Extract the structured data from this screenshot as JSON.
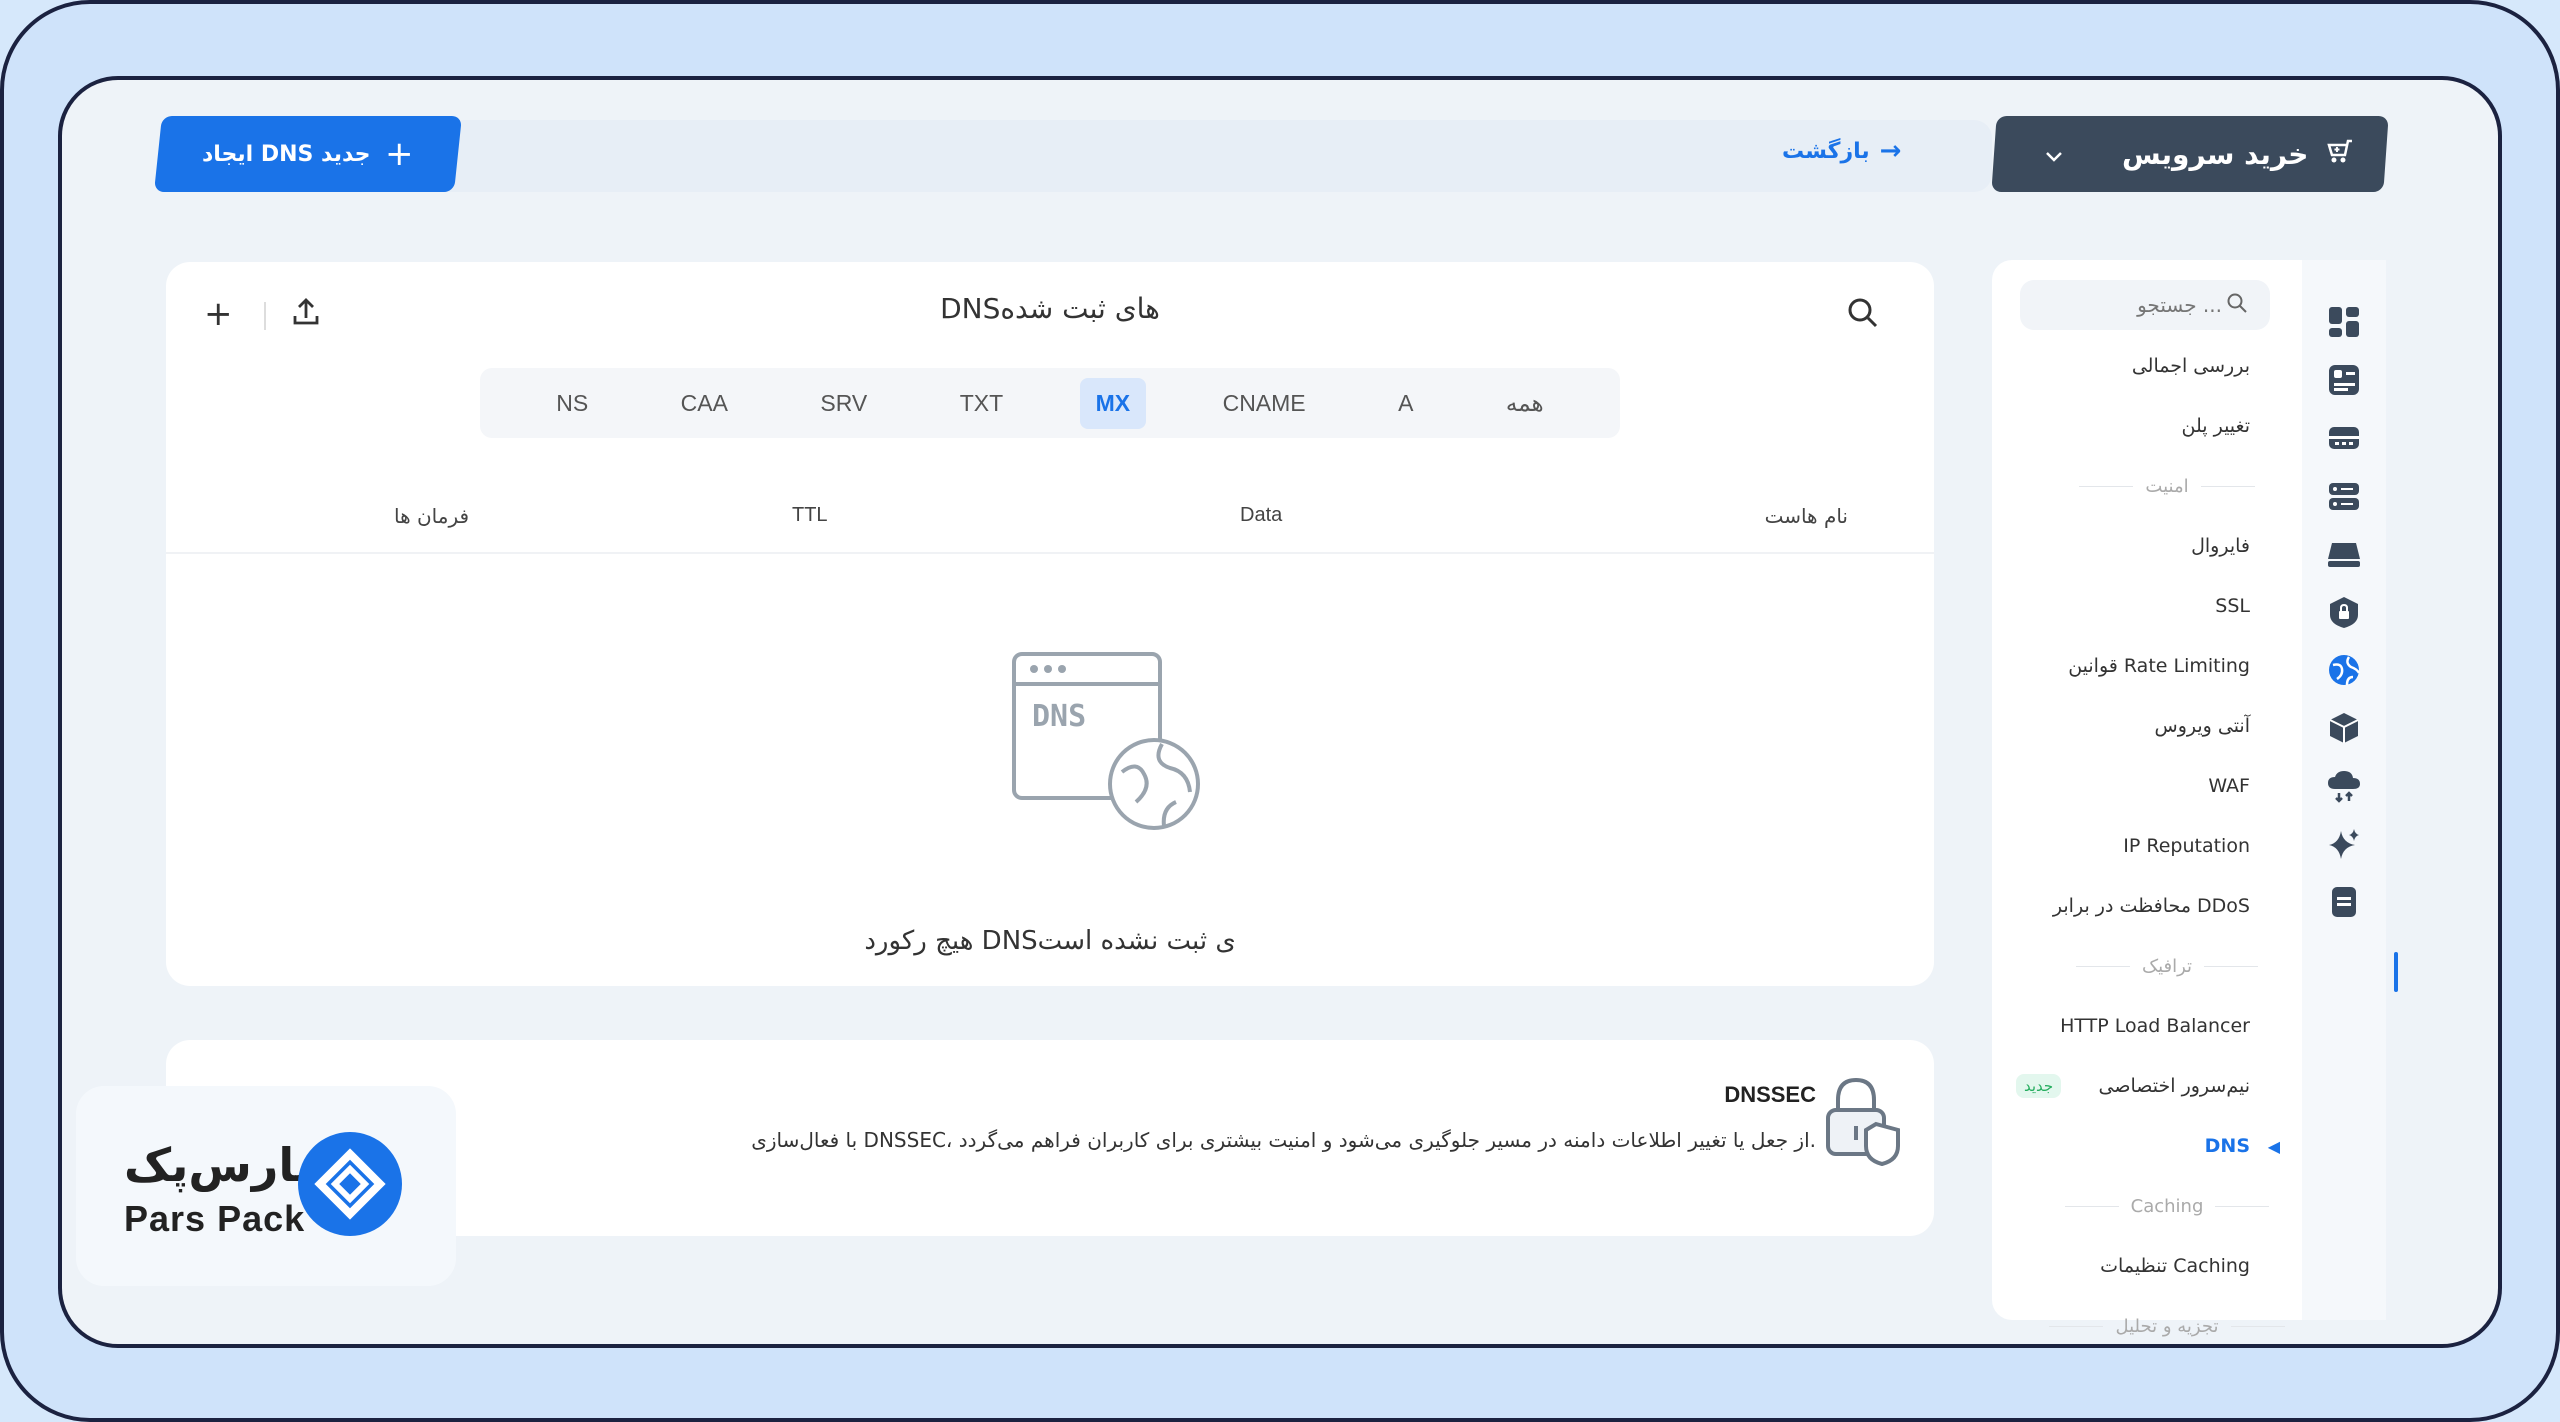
{
  "header": {
    "create_dns_label": "ایجاد DNS جدید",
    "back_label": "بازگشت",
    "buy_service_label": "خرید سرویس"
  },
  "main": {
    "title": "DNSهای ثبت شده",
    "tabs": [
      "همه",
      "A",
      "CNAME",
      "MX",
      "TXT",
      "SRV",
      "CAA",
      "NS"
    ],
    "active_tab": "MX",
    "columns": {
      "host": "نام هاست",
      "data": "Data",
      "ttl": "TTL",
      "actions": "فرمان ها"
    },
    "empty_text": "هیچ رکورد DNSی ثبت نشده است",
    "empty_icon_label": "DNS"
  },
  "dnssec": {
    "title": "DNSSEC",
    "description": "با فعال‌سازی DNSSEC، از جعل یا تغییر اطلاعات دامنه در مسیر جلوگیری می‌شود و امنیت بیشتری برای کاربران فراهم می‌گردد."
  },
  "logo": {
    "fa": "پارس‌پک",
    "en": "Pars Pack"
  },
  "sidebar": {
    "search_placeholder": "جستجو ...",
    "items": [
      {
        "type": "item",
        "label": "بررسی اجمالی"
      },
      {
        "type": "item",
        "label": "تغییر پلن"
      },
      {
        "type": "group",
        "label": "امنیت"
      },
      {
        "type": "item",
        "label": "فایروال"
      },
      {
        "type": "item",
        "label": "SSL"
      },
      {
        "type": "item",
        "label": "قوانین Rate Limiting"
      },
      {
        "type": "item",
        "label": "آنتی ویروس"
      },
      {
        "type": "item",
        "label": "WAF"
      },
      {
        "type": "item",
        "label": "IP Reputation"
      },
      {
        "type": "item",
        "label": "محافظت در برابر DDoS"
      },
      {
        "type": "group",
        "label": "ترافیک"
      },
      {
        "type": "item",
        "label": "HTTP Load Balancer"
      },
      {
        "type": "item",
        "label": "نیم‌سرور اختصاصی",
        "badge": "جدید"
      },
      {
        "type": "item",
        "label": "DNS",
        "active": true
      },
      {
        "type": "group",
        "label": "Caching"
      },
      {
        "type": "item",
        "label": "تنظیمات Caching"
      },
      {
        "type": "group",
        "label": "تجزیه و تحلیل"
      }
    ]
  },
  "rail_icons": [
    "dashboard-icon",
    "plan-icon",
    "firewall-icon",
    "server-icon",
    "cdn-icon",
    "lock-icon",
    "globe-icon",
    "cube-icon",
    "cloud-icon",
    "sparkle-icon",
    "document-icon"
  ],
  "colors": {
    "accent": "#1a73e8",
    "dark": "#3b4a5c",
    "new_badge": "#27ae60"
  }
}
